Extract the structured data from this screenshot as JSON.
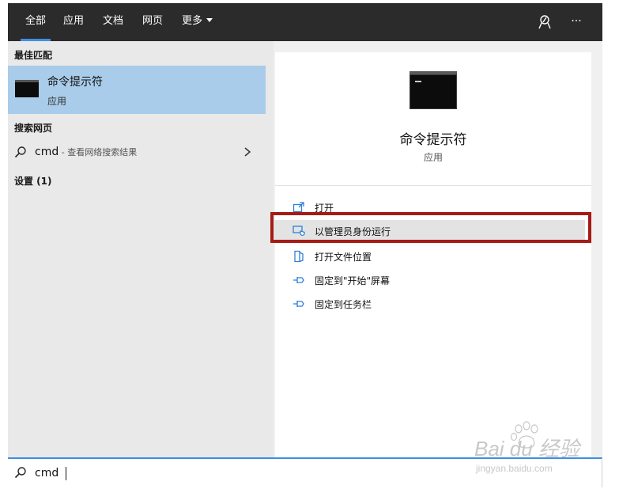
{
  "tabs": [
    {
      "label": "全部",
      "active": true
    },
    {
      "label": "应用",
      "active": false
    },
    {
      "label": "文档",
      "active": false
    },
    {
      "label": "网页",
      "active": false
    },
    {
      "label": "更多",
      "active": false
    }
  ],
  "top_icons": [
    "feedback-icon",
    "more-options-icon"
  ],
  "more_glyph": "···",
  "left": {
    "best_match_header": "最佳匹配",
    "best_match": {
      "title": "命令提示符",
      "subtitle": "应用",
      "icon": "command-prompt-icon"
    },
    "web_header": "搜索网页",
    "web_result": {
      "term": "cmd",
      "hint": " - 查看网络搜索结果",
      "icon": "search-icon"
    },
    "settings_header": "设置 (1)"
  },
  "detail": {
    "title": "命令提示符",
    "type": "应用",
    "actions": [
      {
        "label": "打开",
        "icon": "open-icon"
      },
      {
        "label": "以管理员身份运行",
        "icon": "run-as-admin-icon"
      },
      {
        "label": "打开文件位置",
        "icon": "file-location-icon"
      },
      {
        "label": "固定到\"开始\"屏幕",
        "icon": "pin-icon"
      },
      {
        "label": "固定到任务栏",
        "icon": "pin-icon"
      }
    ]
  },
  "search": {
    "value": "cmd",
    "icon": "search-icon"
  },
  "colors": {
    "tabbar": "#2b2b2b",
    "accent": "#3f8ee8",
    "selection": "#a8cce9",
    "highlight_border": "#a51b16",
    "action_icon": "#2f7fd8"
  },
  "watermark": {
    "brand": "Bai du 经验",
    "url": "jingyan.baidu.com"
  }
}
